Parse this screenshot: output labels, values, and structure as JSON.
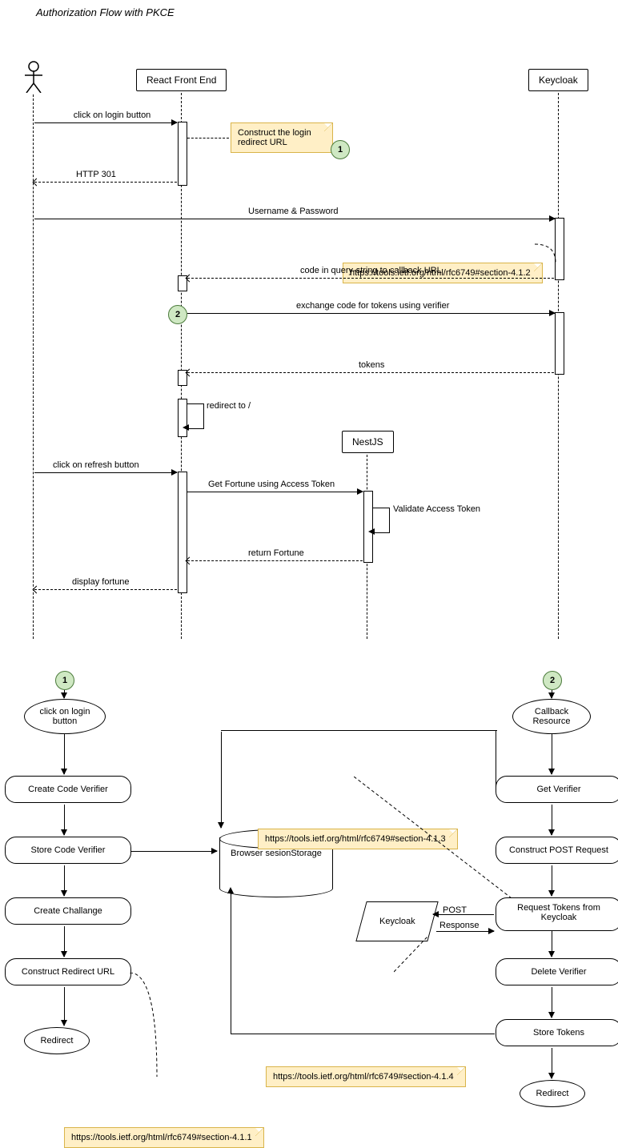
{
  "title": "Authorization Flow with PKCE",
  "participants": {
    "actor": "",
    "react": "React Front End",
    "keycloak": "Keycloak",
    "nestjs": "NestJS"
  },
  "messages": {
    "m1": "click on login button",
    "m2": "HTTP 301",
    "note1": "Construct the login redirect URL",
    "m3": "Username & Password",
    "noteRfc412": "https://tools.ietf.org/html/rfc6749#section-4.1.2",
    "m4": "code in query-string to callback URL",
    "m5": "exchange code for tokens using verifier",
    "m6": "tokens",
    "m7": "redirect to /",
    "m8": "click on refresh button",
    "m9": "Get Fortune using Access Token",
    "m10": "Validate Access Token",
    "m11": "return Fortune",
    "m12": "display fortune"
  },
  "badges": {
    "b1": "1",
    "b2": "2"
  },
  "flowLeft": {
    "start": "click on login button",
    "n1": "Create Code Verifier",
    "n2": "Store Code Verifier",
    "n3": "Create Challange",
    "n4": "Construct Redirect URL",
    "end": "Redirect",
    "note": "https://tools.ietf.org/html/rfc6749#section-4.1.1"
  },
  "flowRight": {
    "start": "Callback Resource",
    "n1": "Get Verifier",
    "n2": "Construct POST Request",
    "n3": "Request Tokens from Keycloak",
    "n4": "Delete Verifier",
    "n5": "Store Tokens",
    "end": "Redirect",
    "note413": "https://tools.ietf.org/html/rfc6749#section-4.1.3",
    "note414": "https://tools.ietf.org/html/rfc6749#section-4.1.4",
    "post": "POST",
    "resp": "Response",
    "kc": "Keycloak"
  },
  "storage": "Browser sesionStorage"
}
